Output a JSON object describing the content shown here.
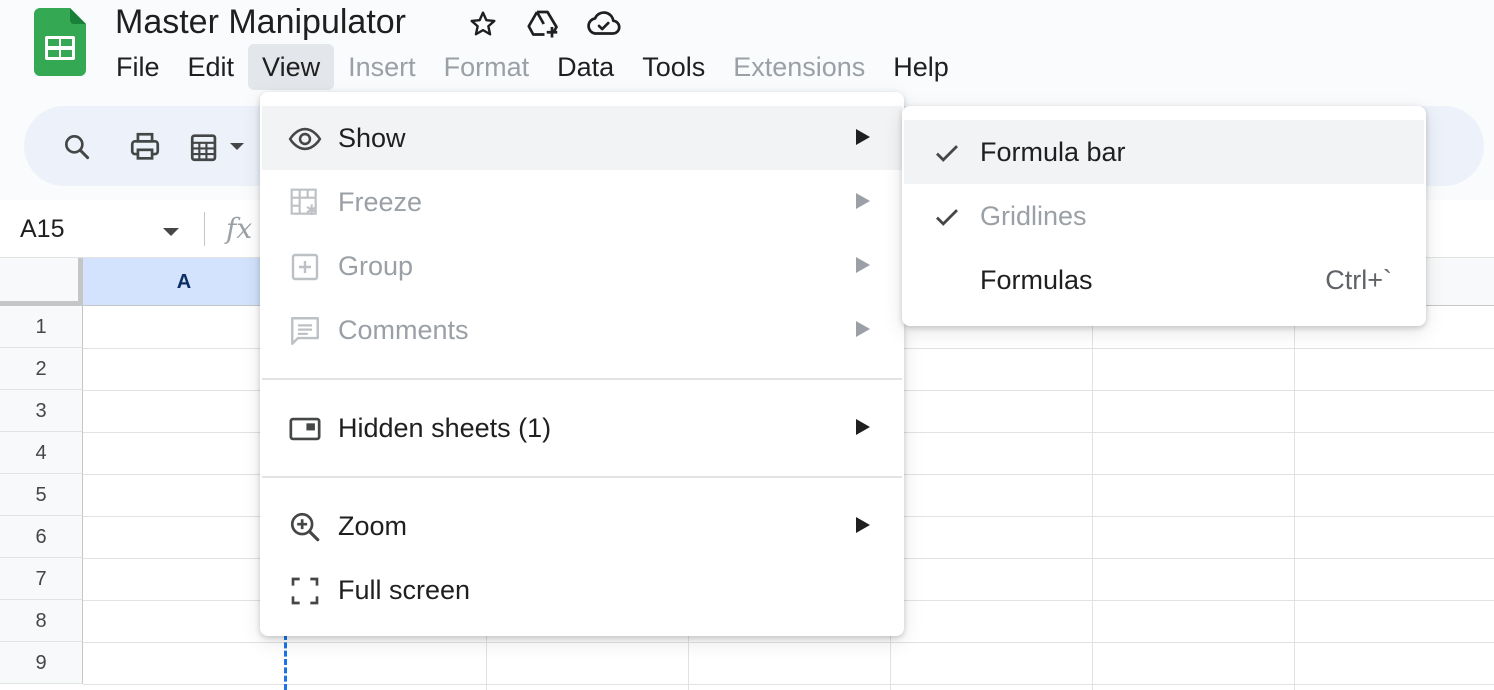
{
  "app": {
    "title": "Master Manipulator",
    "icons": [
      "sheets-logo-icon",
      "star-icon",
      "move-to-drive-icon",
      "cloud-saved-icon"
    ]
  },
  "menubar": [
    {
      "label": "File",
      "state": "normal"
    },
    {
      "label": "Edit",
      "state": "normal"
    },
    {
      "label": "View",
      "state": "active"
    },
    {
      "label": "Insert",
      "state": "disabled"
    },
    {
      "label": "Format",
      "state": "disabled"
    },
    {
      "label": "Data",
      "state": "normal"
    },
    {
      "label": "Tools",
      "state": "normal"
    },
    {
      "label": "Extensions",
      "state": "disabled"
    },
    {
      "label": "Help",
      "state": "normal"
    }
  ],
  "toolbar": {
    "icons": [
      "search-icon",
      "print-icon",
      "format-painter-icon",
      "dropdown-icon"
    ]
  },
  "formula_bar": {
    "cell_ref": "A15",
    "fx": "fx"
  },
  "grid": {
    "selected_column": "A",
    "rows": [
      "1",
      "2",
      "3",
      "4",
      "5",
      "6",
      "7",
      "8",
      "9"
    ]
  },
  "view_menu": {
    "items": [
      {
        "label": "Show",
        "icon": "eye-icon",
        "submenu": true,
        "disabled": false
      },
      {
        "label": "Freeze",
        "icon": "freeze-icon",
        "submenu": true,
        "disabled": true
      },
      {
        "label": "Group",
        "icon": "group-icon",
        "submenu": true,
        "disabled": true
      },
      {
        "label": "Comments",
        "icon": "comments-icon",
        "submenu": true,
        "disabled": true
      },
      {
        "label": "Hidden sheets (1)",
        "icon": "hidden-sheets-icon",
        "submenu": true,
        "disabled": false
      },
      {
        "label": "Zoom",
        "icon": "zoom-in-icon",
        "submenu": true,
        "disabled": false
      },
      {
        "label": "Full screen",
        "icon": "fullscreen-icon",
        "submenu": false,
        "disabled": false
      }
    ]
  },
  "show_menu": {
    "items": [
      {
        "label": "Formula bar",
        "checked": true,
        "disabled": false,
        "shortcut": ""
      },
      {
        "label": "Gridlines",
        "checked": true,
        "disabled": true,
        "shortcut": ""
      },
      {
        "label": "Formulas",
        "checked": false,
        "disabled": false,
        "shortcut": "Ctrl+`"
      }
    ]
  },
  "colors": {
    "accent": "#1a73e8",
    "sheets_green": "#34a853",
    "selected_header": "#d3e3fd",
    "disabled_text": "#9aa0a6"
  }
}
